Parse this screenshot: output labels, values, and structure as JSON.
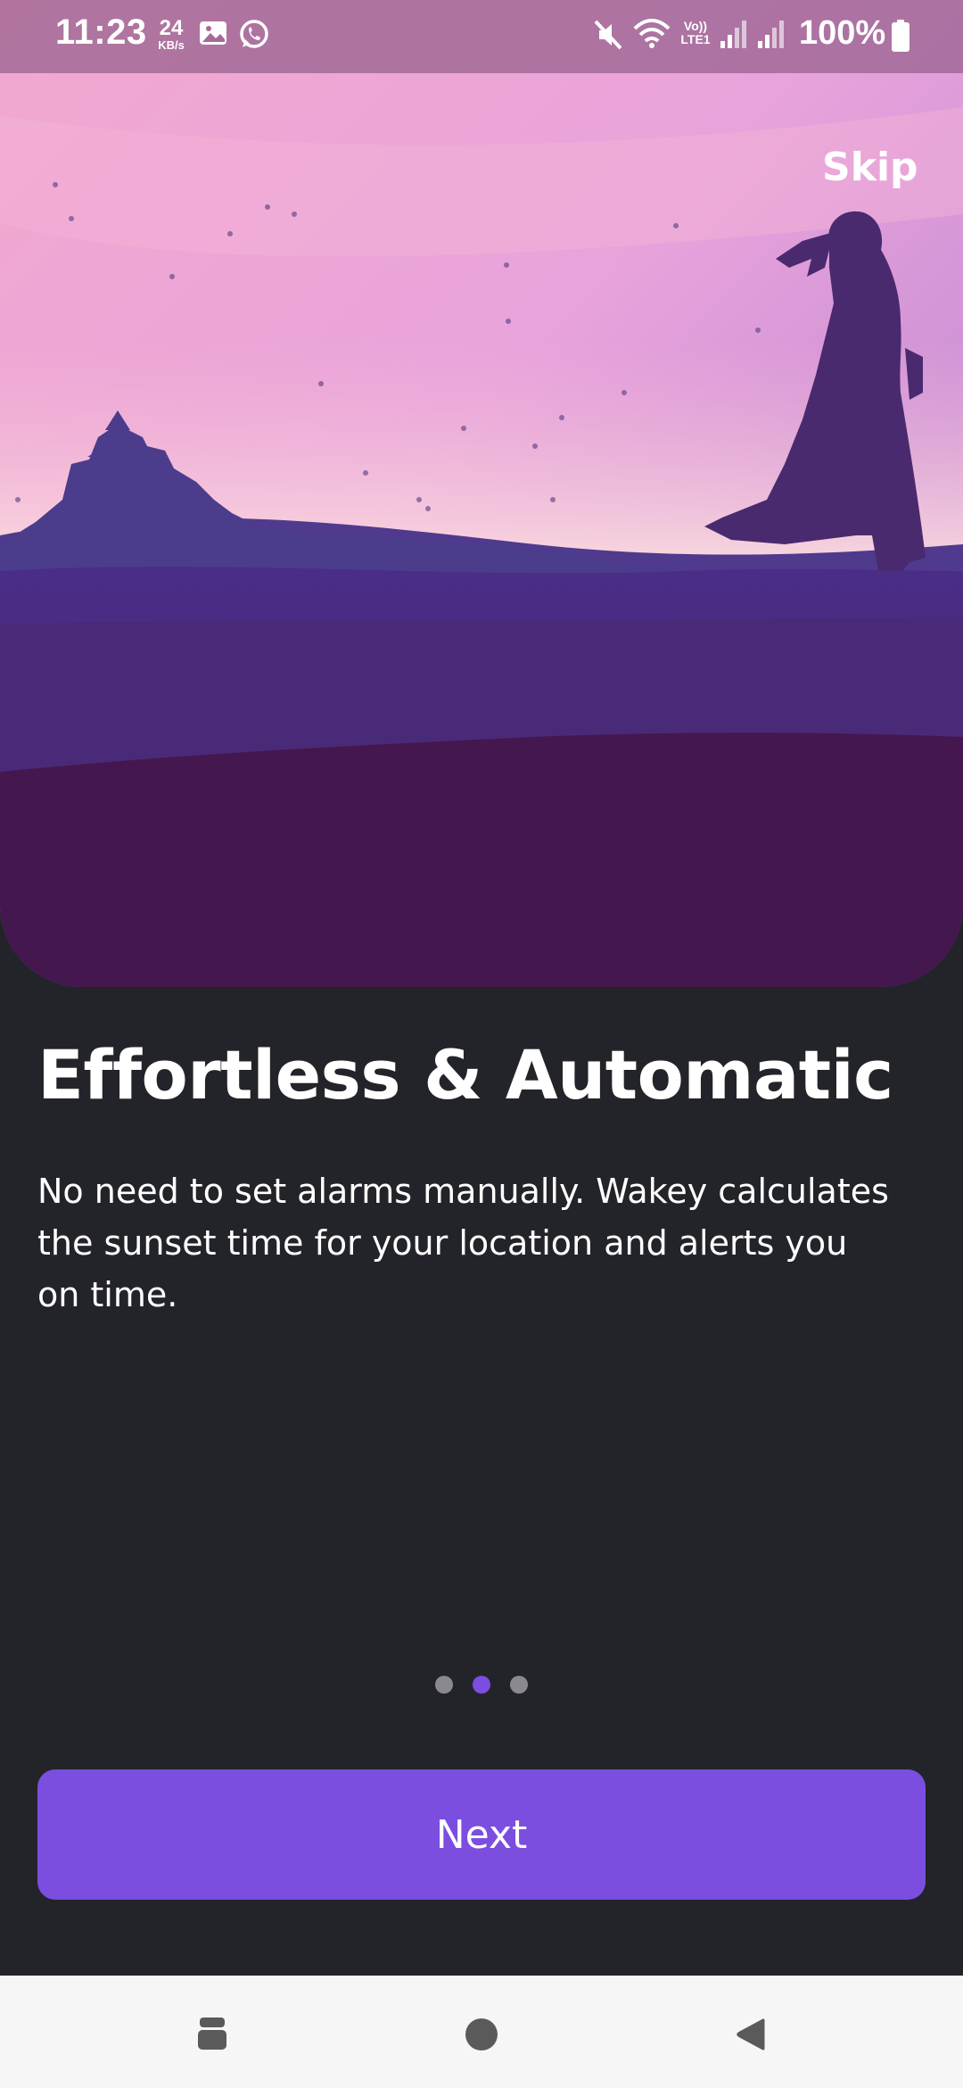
{
  "status_bar": {
    "time": "11:23",
    "net_speed_value": "24",
    "net_speed_unit": "KB/s",
    "volte_label": "Vo)) LTE1",
    "battery_percent": "100%",
    "icons": [
      "gallery-icon",
      "whatsapp-icon",
      "mute-icon",
      "wifi-icon",
      "volte-icon",
      "signal-icon",
      "signal-icon",
      "battery-icon"
    ]
  },
  "onboarding": {
    "skip_label": "Skip",
    "title": "Effortless & Automatic",
    "description": "No need to set alarms manually. Wakey calculates the sunset time for your location and alerts you on time.",
    "page_indicator": {
      "total": 3,
      "current": 2
    },
    "next_label": "Next"
  },
  "nav_bar": {
    "icons": [
      "recents-icon",
      "home-icon",
      "back-icon"
    ]
  },
  "colors": {
    "background": "#232429",
    "accent": "#7b4ee0",
    "indicator_inactive": "#8a8a8e",
    "sky_top": "#e8a6d8",
    "hill_dark": "#45174f"
  }
}
